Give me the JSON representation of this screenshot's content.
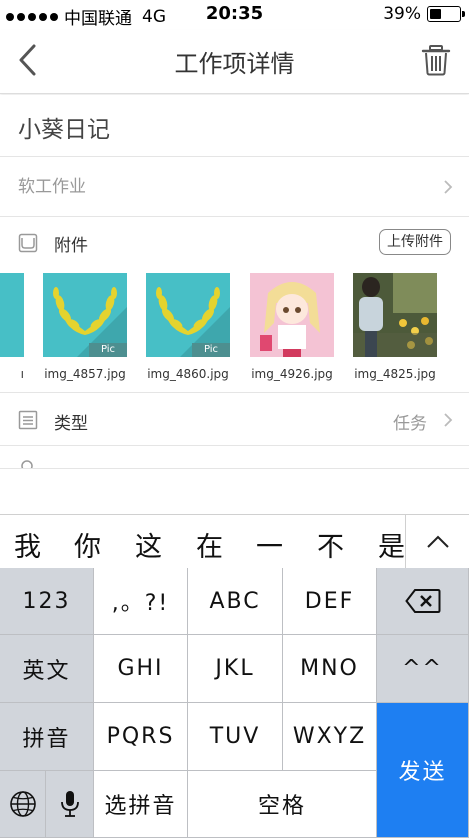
{
  "status_bar": {
    "carrier": "中国联通",
    "network": "4G",
    "time": "20:35",
    "battery": "39%",
    "battery_level": 0.39
  },
  "nav": {
    "title": "工作项详情",
    "back_icon": "chevron-left-icon",
    "delete_icon": "trash-icon"
  },
  "item": {
    "title": "小葵日记",
    "course": "软工作业"
  },
  "attachments": {
    "label": "附件",
    "upload_label": "上传附件",
    "files": [
      {
        "name": "img_4857.jpg",
        "kind": "laurel"
      },
      {
        "name": "img_4860.jpg",
        "kind": "laurel"
      },
      {
        "name": "img_4926.jpg",
        "kind": "anime"
      },
      {
        "name": "img_4825.jpg",
        "kind": "photo"
      }
    ],
    "badge": "Pic"
  },
  "type_row": {
    "label": "类型",
    "value": "任务"
  },
  "candidates": [
    "我",
    "你",
    "这",
    "在",
    "一",
    "不",
    "是"
  ],
  "keyboard": {
    "row1": [
      "123",
      ",。?!",
      "ABC",
      "DEF"
    ],
    "row2": [
      "英文",
      "GHI",
      "JKL",
      "MNO",
      "^^"
    ],
    "row3": [
      "拼音",
      "PQRS",
      "TUV",
      "WXYZ"
    ],
    "row4": [
      "选拼音",
      "空格"
    ],
    "send": "发送"
  },
  "colors": {
    "send": "#1e7ff2",
    "laurel_bg": "#47bfc6",
    "laurel_gold": "#e4d32f"
  }
}
